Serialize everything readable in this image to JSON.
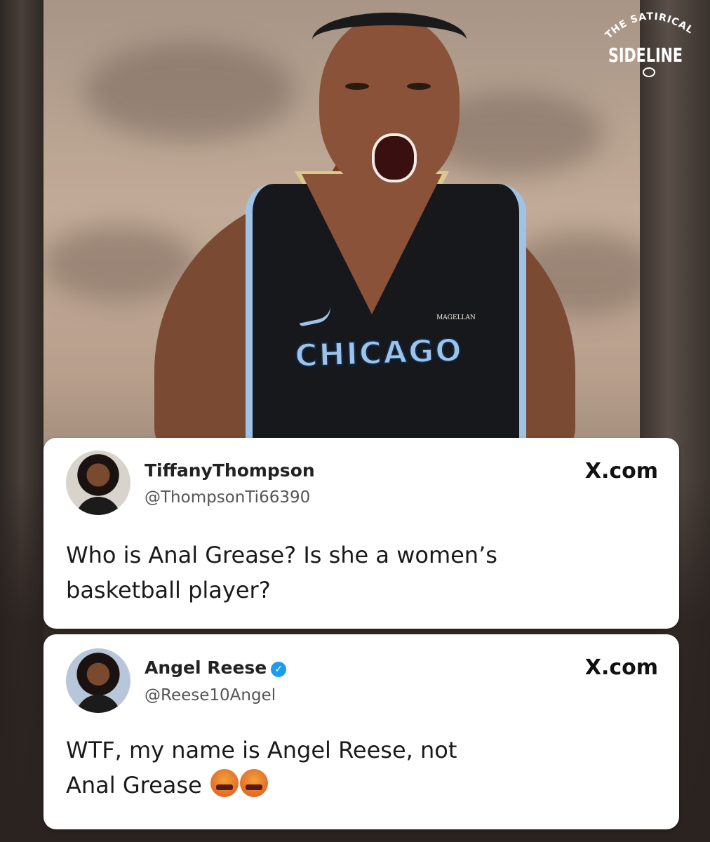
{
  "logo": {
    "arc_text": "THE SATIRICAL",
    "main_text": "SIDELINE"
  },
  "photo": {
    "jersey_text": "CHICAGO",
    "sponsor_text": "MAGELLAN"
  },
  "tweets": [
    {
      "name": "TiffanyThompson",
      "handle": "@ThompsonTi66390",
      "site": "X.com",
      "text_line1": "Who is Anal Grease? Is she a women’s",
      "text_line2": "basketball player?"
    },
    {
      "name": "Angel Reese",
      "verified": true,
      "handle": "@Reese10Angel",
      "site": "X.com",
      "text_line1": "WTF, my name is Angel Reese, not",
      "text_line2": "Anal Grease",
      "emoji": [
        "angry-face-icon",
        "angry-face-icon"
      ]
    }
  ],
  "colors": {
    "verified_blue": "#1d9bf0",
    "jersey_blue": "#9fc3e7",
    "card_bg": "#ffffff"
  }
}
